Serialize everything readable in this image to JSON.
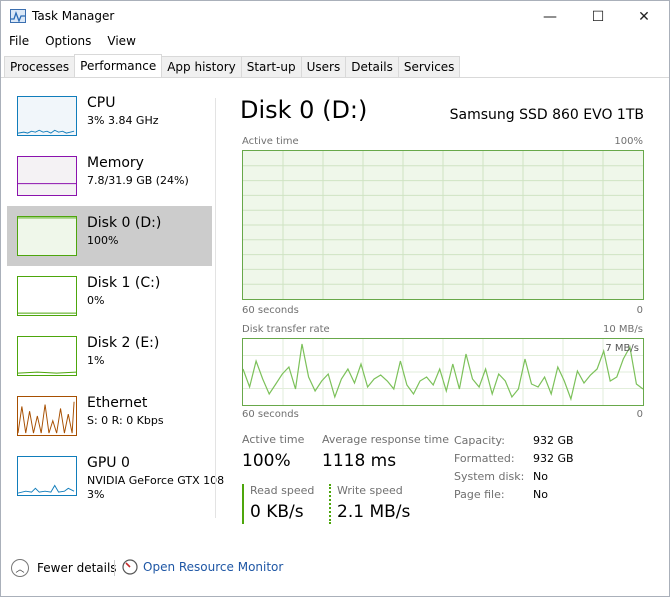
{
  "window": {
    "title": "Task Manager"
  },
  "controls": {
    "minimize": "—",
    "maximize": "☐",
    "close": "✕"
  },
  "menu": [
    "File",
    "Options",
    "View"
  ],
  "tabs": [
    "Processes",
    "Performance",
    "App history",
    "Start-up",
    "Users",
    "Details",
    "Services"
  ],
  "active_tab": "Performance",
  "sidebar": [
    {
      "title": "CPU",
      "sub": "3%  3.84 GHz",
      "sub2": "",
      "color": "#117dbb",
      "fill": "#f1f6fa",
      "selected": false
    },
    {
      "title": "Memory",
      "sub": "7.8/31.9 GB (24%)",
      "sub2": "",
      "color": "#8b12ae",
      "fill": "#f4f2f4",
      "selected": false
    },
    {
      "title": "Disk 0 (D:)",
      "sub": "100%",
      "sub2": "",
      "color": "#4da60c",
      "fill": "#eff7ea",
      "selected": true
    },
    {
      "title": "Disk 1 (C:)",
      "sub": "0%",
      "sub2": "",
      "color": "#4da60c",
      "fill": "#ffffff",
      "selected": false
    },
    {
      "title": "Disk 2 (E:)",
      "sub": "1%",
      "sub2": "",
      "color": "#4da60c",
      "fill": "#ffffff",
      "selected": false
    },
    {
      "title": "Ethernet",
      "sub": "S: 0  R: 0 Kbps",
      "sub2": "",
      "color": "#a74f01",
      "fill": "#ffffff",
      "selected": false
    },
    {
      "title": "GPU 0",
      "sub": "NVIDIA GeForce GTX 108",
      "sub2": "3%",
      "color": "#117dbb",
      "fill": "#ffffff",
      "selected": false
    }
  ],
  "disk": {
    "title": "Disk 0 (D:)",
    "model": "Samsung SSD 860 EVO 1TB",
    "graph1": {
      "label": "Active time",
      "max": "100%",
      "left_bottom": "60 seconds",
      "right_bottom": "0"
    },
    "graph2": {
      "label": "Disk transfer rate",
      "max": "10 MB/s",
      "inner_max": "7 MB/s",
      "left_bottom": "60 seconds",
      "right_bottom": "0"
    },
    "stats": {
      "active_time_label": "Active time",
      "active_time": "100%",
      "avg_resp_label": "Average response time",
      "avg_resp": "1118 ms",
      "read_label": "Read speed",
      "read": "0 KB/s",
      "write_label": "Write speed",
      "write": "2.1 MB/s"
    },
    "props": [
      {
        "k": "Capacity:",
        "v": "932 GB"
      },
      {
        "k": "Formatted:",
        "v": "932 GB"
      },
      {
        "k": "System disk:",
        "v": "No"
      },
      {
        "k": "Page file:",
        "v": "No"
      }
    ]
  },
  "footer": {
    "fewer": "Fewer details",
    "monitor": "Open Resource Monitor"
  }
}
